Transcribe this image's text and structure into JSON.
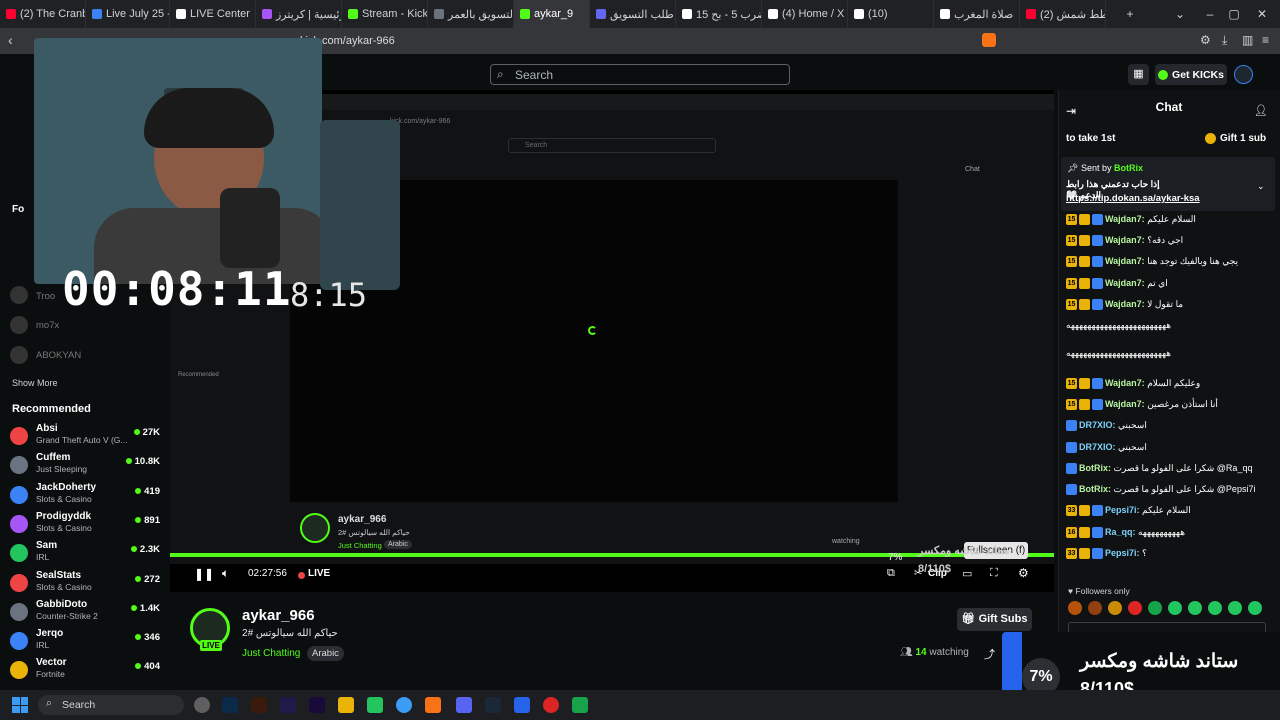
{
  "browser": {
    "tabs": [
      {
        "label": "(2) The Cranbo",
        "color": "#ff0033"
      },
      {
        "label": "Live July 25 - R",
        "color": "#3b82f6"
      },
      {
        "label": "LIVE Center",
        "color": "#ffffff"
      },
      {
        "label": "الرئيسية | كريترز",
        "color": "#a855f7"
      },
      {
        "label": "Stream - Kick C",
        "color": "#53fc18"
      },
      {
        "label": "التسويق بالعمر",
        "color": "#6b7280"
      },
      {
        "label": "aykar_9",
        "color": "#53fc18"
      },
      {
        "label": "طلب التسويق",
        "color": "#6366f1"
      },
      {
        "label": "15 ضرب 5 - بح",
        "color": "#ffffff"
      },
      {
        "label": "(4) Home / X",
        "color": "#ffffff"
      },
      {
        "label": "(10)",
        "color": "#ffffff"
      },
      {
        "label": "صلاة المغرب",
        "color": "#ffffff"
      },
      {
        "label": "(2) خطط شمش",
        "color": "#ff0033"
      }
    ],
    "active_tab_index": 6,
    "url": "kick.com/aykar-966"
  },
  "site": {
    "search_placeholder": "Search",
    "get_kicks": "Get KICKs"
  },
  "sidebar": {
    "following_label": "Fo",
    "followed": [
      {
        "name": "Troo"
      },
      {
        "name": "mo7x"
      },
      {
        "name": "ABOKYAN"
      }
    ],
    "show_more": "Show More",
    "recommended_title": "Recommended",
    "recommended": [
      {
        "name": "Absi",
        "category": "Grand Theft Auto V (G...",
        "viewers": "27K",
        "color": "#ef4444"
      },
      {
        "name": "Cuffem",
        "category": "Just Sleeping",
        "viewers": "10.8K",
        "color": "#6b7280"
      },
      {
        "name": "JackDoherty",
        "category": "Slots & Casino",
        "viewers": "419",
        "color": "#3b82f6"
      },
      {
        "name": "Prodigyddk",
        "category": "Slots & Casino",
        "viewers": "891",
        "color": "#a855f7"
      },
      {
        "name": "Sam",
        "category": "IRL",
        "viewers": "2.3K",
        "color": "#22c55e"
      },
      {
        "name": "SealStats",
        "category": "Slots & Casino",
        "viewers": "272",
        "color": "#ef4444"
      },
      {
        "name": "GabbiDoto",
        "category": "Counter-Strike 2",
        "viewers": "1.4K",
        "color": "#6b7280"
      },
      {
        "name": "Jerqo",
        "category": "IRL",
        "viewers": "346",
        "color": "#3b82f6"
      },
      {
        "name": "Vector",
        "category": "Fortnite",
        "viewers": "404",
        "color": "#eab308"
      }
    ]
  },
  "player": {
    "timer_big": "00:08:11",
    "timer_small": "8:15",
    "elapsed": "02:27:56",
    "live_label": "LIVE",
    "clip_label": "Clip",
    "fullscreen_tooltip": "Fullscreen (f)",
    "inner_channel": "aykar_966",
    "inner_title": "حياكم الله سيالوتس #2",
    "inner_category": "Just Chatting",
    "inner_lang": "Arabic",
    "inner_watching": "watching",
    "inner_chat": "Chat",
    "inner_search": "Search",
    "inner_recommended": "Recommended",
    "inner_url": "kick.com/aykar-966"
  },
  "stream": {
    "channel": "aykar_966",
    "live": "LIVE",
    "title": "حياكم الله سيالوتس #2",
    "category": "Just Chatting",
    "language": "Arabic",
    "watching_count": "14",
    "watching_label": "watching",
    "gift_subs": "Gift Subs"
  },
  "chat": {
    "title": "Chat",
    "top_left": "to take 1st",
    "top_right": "Gift 1 sub",
    "pinned_by": "Sent by",
    "pinned_user": "BotRix",
    "pinned_text": "إذا حاب تدعمني هذا رابط الدعم 🤍",
    "pinned_link": "https://tip.dokan.sa/aykar-ksa",
    "messages": [
      {
        "badge": "15",
        "user": "Wajdan7:",
        "text": "السلام عليكم",
        "color": "#e6e6e6"
      },
      {
        "badge": "15",
        "user": "Wajdan7:",
        "text": "اجي دقه؟",
        "color": "#e6e6e6"
      },
      {
        "badge": "15",
        "user": "Wajdan7:",
        "text": "يجي هنا وبالفيك توجد هنا",
        "color": "#e6e6e6"
      },
      {
        "badge": "15",
        "user": "Wajdan7:",
        "text": "اي تم",
        "color": "#e6e6e6"
      },
      {
        "badge": "15",
        "user": "Wajdan7:",
        "text": "ما تقول لا",
        "color": "#e6e6e6"
      },
      {
        "badge": "",
        "user": "",
        "text": "ههههههههههههههههههههههههه",
        "color": "#e6e6e6"
      },
      {
        "badge": "",
        "user": "",
        "text": "ههههههههههههههههههههههههه",
        "color": "#e6e6e6"
      },
      {
        "badge": "15",
        "user": "Wajdan7:",
        "text": "وعليكم السلام",
        "color": "#e6e6e6"
      },
      {
        "badge": "15",
        "user": "Wajdan7:",
        "text": "أنا استأذن مرغصين",
        "color": "#e6e6e6"
      },
      {
        "badge": "",
        "user": "DR7XIO:",
        "text": "اسحبني",
        "color": "#e6e6e6"
      },
      {
        "badge": "",
        "user": "DR7XIO:",
        "text": "اسحبني",
        "color": "#e6e6e6"
      },
      {
        "badge": "",
        "user": "BotRix:",
        "text": "شكرا على الفولو ما قصرت @Ra_qq",
        "color": "#e6e6e6"
      },
      {
        "badge": "",
        "user": "BotRix:",
        "text": "شكرا على الفولو ما قصرت @Pepsi7i",
        "color": "#e6e6e6"
      },
      {
        "badge": "33",
        "user": "Pepsi7i:",
        "text": "السلام عليكم",
        "color": "#e6e6e6"
      },
      {
        "badge": "16",
        "user": "Ra_qq:",
        "text": "ههههههههههه",
        "color": "#e6e6e6"
      },
      {
        "badge": "33",
        "user": "Pepsi7i:",
        "text": "؟",
        "color": "#e6e6e6"
      }
    ],
    "followers_only": "Followers only"
  },
  "overlay": {
    "percent": "7%",
    "goal_title": "ستاند شاشه ومكسر",
    "goal_amount": "8/110$"
  },
  "taskbar": {
    "search": "Search"
  },
  "colors": {
    "accent": "#53fc18",
    "bg": "#0b0e0f"
  }
}
